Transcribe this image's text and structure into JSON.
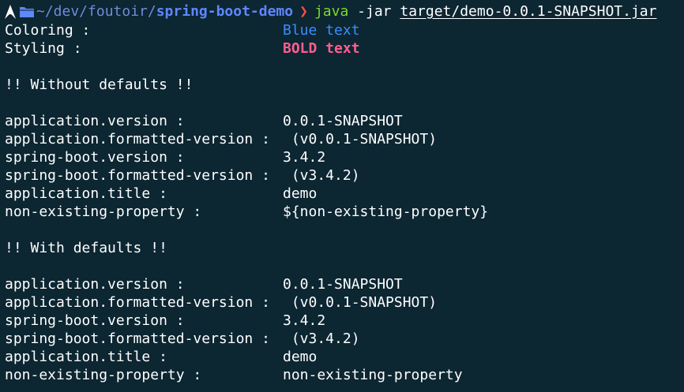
{
  "prompt": {
    "path_prefix": "~/dev/foutoir/",
    "path_dir": "spring-boot-demo",
    "chevron": "❯",
    "command": "java",
    "args": "-jar",
    "jar_path": "target/demo-0.0.1-SNAPSHOT.jar"
  },
  "styling_section": {
    "coloring_label": "Coloring :",
    "coloring_value": "Blue text",
    "styling_label": "Styling :",
    "styling_value": "BOLD text"
  },
  "without_defaults": {
    "heading": "!! Without defaults !!",
    "rows": [
      {
        "label": "application.version :",
        "value": "0.0.1-SNAPSHOT"
      },
      {
        "label": "application.formatted-version :",
        "value": " (v0.0.1-SNAPSHOT)"
      },
      {
        "label": "spring-boot.version :",
        "value": "3.4.2"
      },
      {
        "label": "spring-boot.formatted-version :",
        "value": " (v3.4.2)"
      },
      {
        "label": "application.title :",
        "value": "demo"
      },
      {
        "label": "non-existing-property :",
        "value": "${non-existing-property}"
      }
    ]
  },
  "with_defaults": {
    "heading": "!! With defaults !!",
    "rows": [
      {
        "label": "application.version :",
        "value": "0.0.1-SNAPSHOT"
      },
      {
        "label": "application.formatted-version :",
        "value": " (v0.0.1-SNAPSHOT)"
      },
      {
        "label": "spring-boot.version :",
        "value": "3.4.2"
      },
      {
        "label": "spring-boot.formatted-version :",
        "value": " (v3.4.2)"
      },
      {
        "label": "application.title :",
        "value": "demo"
      },
      {
        "label": "non-existing-property :",
        "value": "non-existing-property"
      }
    ]
  },
  "colors": {
    "background": "#0c2632",
    "path": "#5f87ff",
    "chevron": "#ff4d4d",
    "command": "#7fd62a",
    "blue_text": "#3c8dff",
    "bold_text": "#ff5d8f"
  },
  "icons": [
    "arch-linux-icon",
    "folder-icon"
  ]
}
